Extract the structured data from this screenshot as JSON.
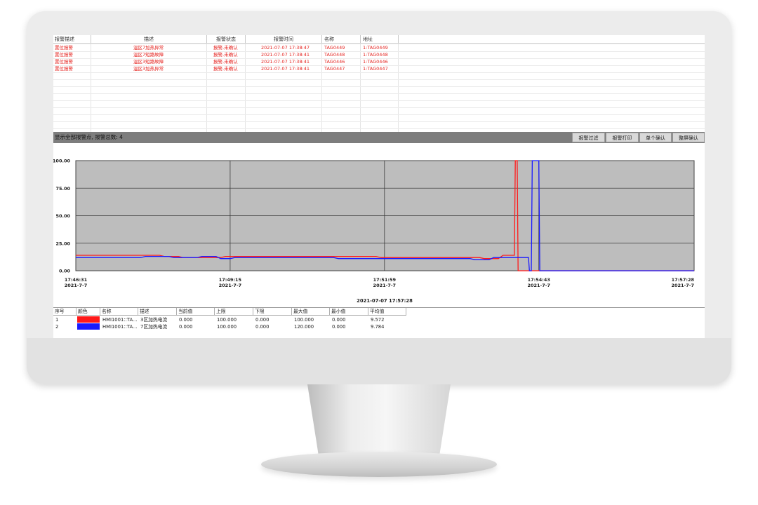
{
  "alarm_table": {
    "columns": [
      "报警描述",
      "描述",
      "报警状态",
      "报警时间",
      "名称",
      "地址"
    ],
    "rows": [
      {
        "type": "置位报警",
        "desc": "温区7加热异常",
        "status": "报警,未确认",
        "time": "2021-07-07 17:38:47",
        "name": "TAG0449",
        "addr": "1:TAG0449"
      },
      {
        "type": "置位报警",
        "desc": "温区7短路故障",
        "status": "报警,未确认",
        "time": "2021-07-07 17:38:41",
        "name": "TAG0448",
        "addr": "1:TAG0448"
      },
      {
        "type": "置位报警",
        "desc": "温区3短路故障",
        "status": "报警,未确认",
        "time": "2021-07-07 17:38:41",
        "name": "TAG0446",
        "addr": "1:TAG0446"
      },
      {
        "type": "置位报警",
        "desc": "温区3加热异常",
        "status": "报警,未确认",
        "time": "2021-07-07 17:38:41",
        "name": "TAG0447",
        "addr": "1:TAG0447"
      }
    ]
  },
  "status_bar": {
    "text": "显示全部报警点, 报警总数: 4",
    "buttons": [
      "报警过滤",
      "报警打印",
      "单个确认",
      "整屏确认"
    ]
  },
  "colors": {
    "alarm_text": "#e5231f",
    "plot_bg": "#bdbdbd",
    "series_red": "#ff1a1a",
    "series_blue": "#1a1aff"
  },
  "chart_data": {
    "type": "line",
    "ylim": [
      0,
      100
    ],
    "yticks": [
      "100.00",
      "75.00",
      "50.00",
      "25.00",
      "0.00"
    ],
    "xticks": [
      {
        "time": "17:46:31",
        "date": "2021-7-7"
      },
      {
        "time": "17:49:15",
        "date": "2021-7-7"
      },
      {
        "time": "17:51:59",
        "date": "2021-7-7"
      },
      {
        "time": "17:54:43",
        "date": "2021-7-7"
      },
      {
        "time": "17:57:28",
        "date": "2021-7-7"
      }
    ],
    "x_range": [
      "17:46:31",
      "17:57:28"
    ],
    "current_time": "2021-07-07 17:57:28",
    "grid": true,
    "series": [
      {
        "color": "#ff1a1a",
        "points": [
          [
            "17:46:31",
            14
          ],
          [
            "17:48:00",
            14
          ],
          [
            "17:48:05",
            13
          ],
          [
            "17:48:20",
            13
          ],
          [
            "17:48:25",
            12
          ],
          [
            "17:49:05",
            12
          ],
          [
            "17:49:10",
            13
          ],
          [
            "17:51:50",
            13
          ],
          [
            "17:51:55",
            12
          ],
          [
            "17:53:40",
            12
          ],
          [
            "17:53:45",
            11
          ],
          [
            "17:54:00",
            11
          ],
          [
            "17:54:05",
            14
          ],
          [
            "17:54:17",
            14
          ],
          [
            "17:54:18",
            100
          ],
          [
            "17:54:20",
            100
          ],
          [
            "17:54:21",
            0
          ],
          [
            "17:57:28",
            0
          ]
        ]
      },
      {
        "color": "#1a1aff",
        "points": [
          [
            "17:46:31",
            12
          ],
          [
            "17:47:40",
            12
          ],
          [
            "17:47:45",
            13
          ],
          [
            "17:48:10",
            13
          ],
          [
            "17:48:15",
            12
          ],
          [
            "17:48:40",
            12
          ],
          [
            "17:48:45",
            13
          ],
          [
            "17:49:00",
            13
          ],
          [
            "17:49:05",
            11
          ],
          [
            "17:49:15",
            11
          ],
          [
            "17:49:20",
            12
          ],
          [
            "17:51:05",
            12
          ],
          [
            "17:51:10",
            11
          ],
          [
            "17:53:30",
            11
          ],
          [
            "17:53:35",
            10
          ],
          [
            "17:53:50",
            10
          ],
          [
            "17:53:55",
            12
          ],
          [
            "17:54:32",
            12
          ],
          [
            "17:54:33",
            0
          ],
          [
            "17:54:35",
            0
          ],
          [
            "17:54:36",
            100
          ],
          [
            "17:54:43",
            100
          ],
          [
            "17:54:44",
            0
          ],
          [
            "17:57:28",
            0
          ]
        ]
      }
    ]
  },
  "legend_table": {
    "columns": [
      "序号",
      "颜色",
      "名称",
      "描述",
      "当前值",
      "上限",
      "下限",
      "最大值",
      "最小值",
      "平均值"
    ],
    "rows": [
      {
        "no": "1",
        "color": "#ff1a1a",
        "name": "HMI1001::TA...",
        "desc": "3区加热电流",
        "current": "0.000",
        "upper": "100.000",
        "lower": "0.000",
        "max": "100.000",
        "min": "0.000",
        "avg": "9.572"
      },
      {
        "no": "2",
        "color": "#1a1aff",
        "name": "HMI1001::TA...",
        "desc": "7区加热电流",
        "current": "0.000",
        "upper": "100.000",
        "lower": "0.000",
        "max": "120.000",
        "min": "0.000",
        "avg": "9.784"
      }
    ]
  }
}
